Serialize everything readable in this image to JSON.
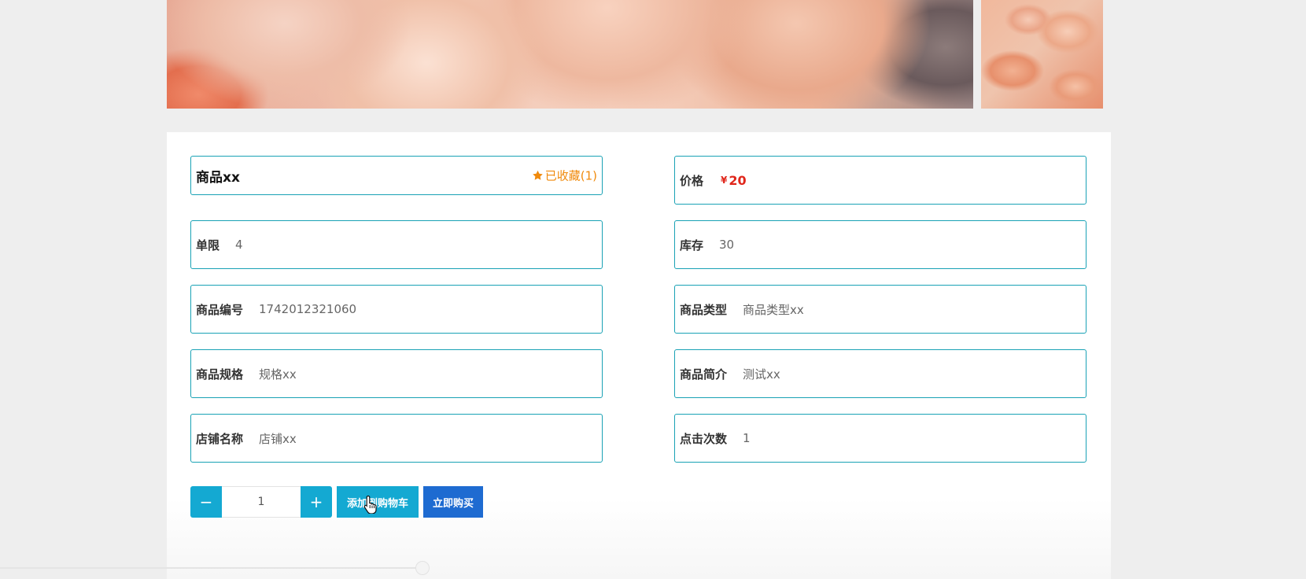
{
  "product": {
    "name": "商品xx",
    "favorite_label": "已收藏(1)",
    "price_label": "价格",
    "price_symbol": "¥",
    "price_value": "20"
  },
  "fields": {
    "limit": {
      "label": "单限",
      "value": "4"
    },
    "stock": {
      "label": "库存",
      "value": "30"
    },
    "code": {
      "label": "商品编号",
      "value": "1742012321060"
    },
    "type": {
      "label": "商品类型",
      "value": "商品类型xx"
    },
    "spec": {
      "label": "商品规格",
      "value": "规格xx"
    },
    "intro": {
      "label": "商品简介",
      "value": "测试xx"
    },
    "shop": {
      "label": "店铺名称",
      "value": "店铺xx"
    },
    "clicks": {
      "label": "点击次数",
      "value": "1"
    }
  },
  "controls": {
    "minus": "−",
    "plus": "+",
    "quantity": "1",
    "add_to_cart": "添加到购物车",
    "buy_now": "立即购买"
  },
  "icons": {
    "favorite": "star-icon",
    "cursor": "hand-pointer-icon"
  },
  "colors": {
    "border": "#19a2b5",
    "price": "#e0261b",
    "favorite": "#f08a0c",
    "primary": "#14a9d2",
    "buy": "#1e6bd1"
  }
}
